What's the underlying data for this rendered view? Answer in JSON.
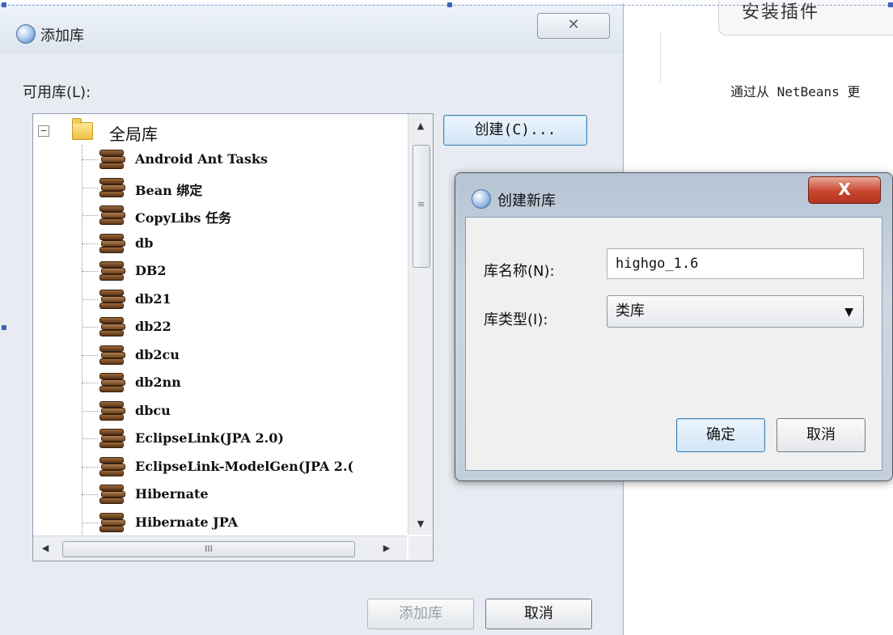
{
  "background": {
    "tab_title": "安装插件",
    "text": "通过从 NetBeans 更"
  },
  "add_dialog": {
    "title": "添加库",
    "close_glyph": "✕",
    "available_label": "可用库(L):",
    "tree_root": "全局库",
    "libraries": [
      "Android Ant Tasks",
      "Bean 绑定",
      "CopyLibs 任务",
      "db",
      "DB2",
      "db21",
      "db22",
      "db2cu",
      "db2nn",
      "dbcu",
      "EclipseLink(JPA 2.0)",
      "EclipseLink-ModelGen(JPA 2.(",
      "Hibernate",
      "Hibernate JPA"
    ],
    "create_button": "创建(C)...",
    "add_button": "添加库",
    "cancel_button": "取消",
    "hscroll_grip": "III",
    "vscroll_grip": "≡"
  },
  "new_dialog": {
    "title": "创建新库",
    "close_glyph": "X",
    "name_label": "库名称(N):",
    "name_value": "highgo_1.6",
    "type_label": "库类型(I):",
    "type_value": "类库",
    "ok_button": "确定",
    "cancel_button": "取消"
  }
}
